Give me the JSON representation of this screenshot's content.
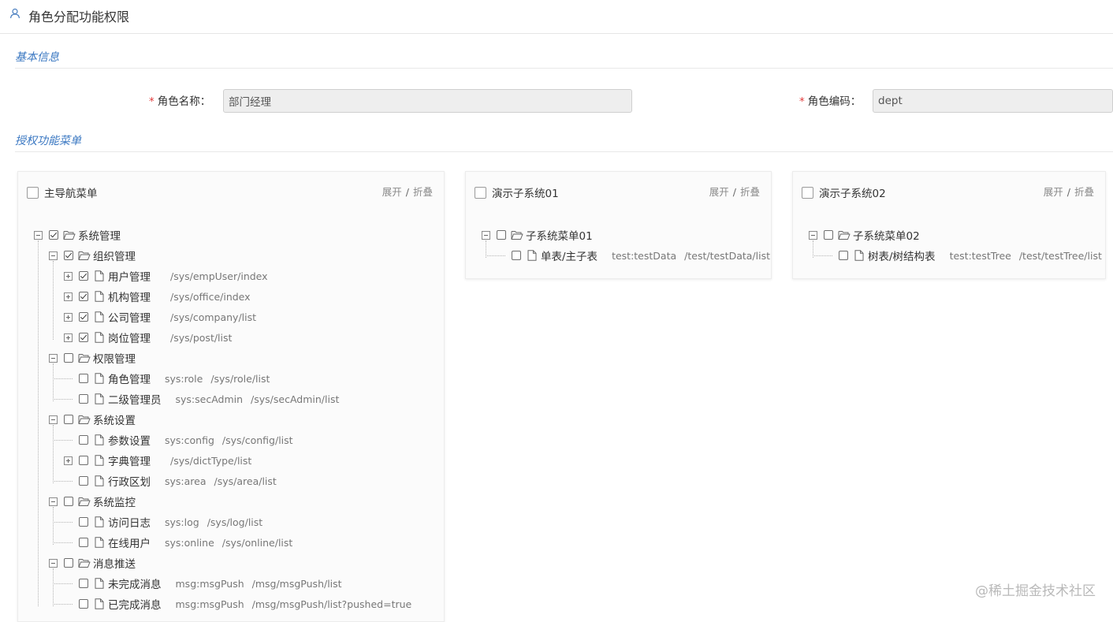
{
  "header": {
    "title": "角色分配功能权限",
    "icon": "user-icon"
  },
  "sections": {
    "basic": "基本信息",
    "menu": "授权功能菜单"
  },
  "form": {
    "required_mark": "*",
    "role_name_label": "角色名称：",
    "role_name_value": "部门经理",
    "role_code_label": "角色编码：",
    "role_code_value": "dept"
  },
  "panel_actions": {
    "expand": "展开",
    "sep": "/",
    "collapse": "折叠"
  },
  "panels": [
    {
      "title": "主导航菜单",
      "tree": [
        {
          "label": "系统管理",
          "type": "folder",
          "checked": true,
          "expanded": true,
          "children": [
            {
              "label": "组织管理",
              "type": "folder",
              "checked": true,
              "expanded": true,
              "children": [
                {
                  "label": "用户管理",
                  "type": "file",
                  "checked": true,
                  "has_children": true,
                  "perm": "",
                  "href": "/sys/empUser/index"
                },
                {
                  "label": "机构管理",
                  "type": "file",
                  "checked": true,
                  "has_children": true,
                  "perm": "",
                  "href": "/sys/office/index"
                },
                {
                  "label": "公司管理",
                  "type": "file",
                  "checked": true,
                  "has_children": true,
                  "perm": "",
                  "href": "/sys/company/list"
                },
                {
                  "label": "岗位管理",
                  "type": "file",
                  "checked": true,
                  "has_children": true,
                  "perm": "",
                  "href": "/sys/post/list"
                }
              ]
            },
            {
              "label": "权限管理",
              "type": "folder",
              "checked": false,
              "expanded": true,
              "children": [
                {
                  "label": "角色管理",
                  "type": "file",
                  "checked": false,
                  "perm": "sys:role",
                  "href": "/sys/role/list"
                },
                {
                  "label": "二级管理员",
                  "type": "file",
                  "checked": false,
                  "perm": "sys:secAdmin",
                  "href": "/sys/secAdmin/list"
                }
              ]
            },
            {
              "label": "系统设置",
              "type": "folder",
              "checked": false,
              "expanded": true,
              "children": [
                {
                  "label": "参数设置",
                  "type": "file",
                  "checked": false,
                  "perm": "sys:config",
                  "href": "/sys/config/list"
                },
                {
                  "label": "字典管理",
                  "type": "file",
                  "checked": false,
                  "has_children": true,
                  "perm": "",
                  "href": "/sys/dictType/list"
                },
                {
                  "label": "行政区划",
                  "type": "file",
                  "checked": false,
                  "perm": "sys:area",
                  "href": "/sys/area/list"
                }
              ]
            },
            {
              "label": "系统监控",
              "type": "folder",
              "checked": false,
              "expanded": true,
              "children": [
                {
                  "label": "访问日志",
                  "type": "file",
                  "checked": false,
                  "perm": "sys:log",
                  "href": "/sys/log/list"
                },
                {
                  "label": "在线用户",
                  "type": "file",
                  "checked": false,
                  "perm": "sys:online",
                  "href": "/sys/online/list"
                }
              ]
            },
            {
              "label": "消息推送",
              "type": "folder",
              "checked": false,
              "expanded": true,
              "children": [
                {
                  "label": "未完成消息",
                  "type": "file",
                  "checked": false,
                  "perm": "msg:msgPush",
                  "href": "/msg/msgPush/list"
                },
                {
                  "label": "已完成消息",
                  "type": "file",
                  "checked": false,
                  "perm": "msg:msgPush",
                  "href": "/msg/msgPush/list?pushed=true"
                }
              ]
            }
          ]
        }
      ]
    },
    {
      "title": "演示子系统01",
      "tree": [
        {
          "label": "子系统菜单01",
          "type": "folder",
          "checked": false,
          "expanded": true,
          "children": [
            {
              "label": "单表/主子表",
              "type": "file",
              "checked": false,
              "perm": "test:testData",
              "href": "/test/testData/list"
            }
          ]
        }
      ]
    },
    {
      "title": "演示子系统02",
      "tree": [
        {
          "label": "子系统菜单02",
          "type": "folder",
          "checked": false,
          "expanded": true,
          "children": [
            {
              "label": "树表/树结构表",
              "type": "file",
              "checked": false,
              "perm": "test:testTree",
              "href": "/test/testTree/list"
            }
          ]
        }
      ]
    }
  ],
  "watermark": "@稀土掘金技术社区"
}
